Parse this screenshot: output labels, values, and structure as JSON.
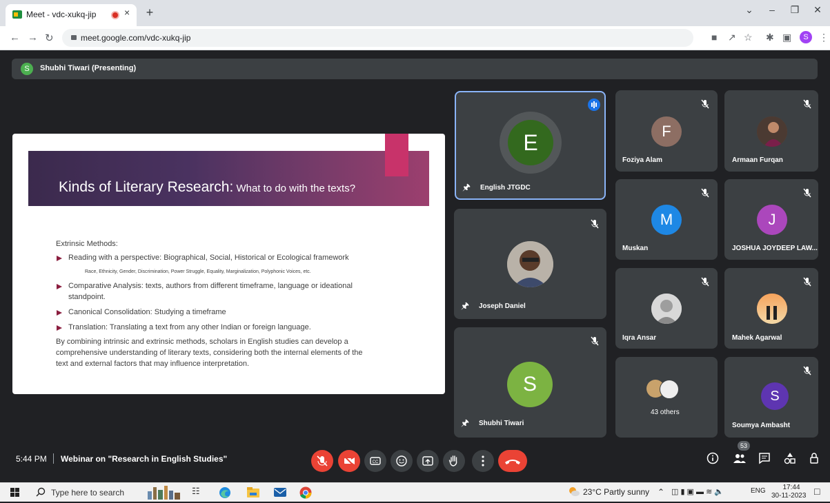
{
  "browser": {
    "tab_title": "Meet - vdc-xukq-jip",
    "tab_close": "×",
    "new_tab": "+",
    "url": "meet.google.com/vdc-xukq-jip",
    "profile_initial": "S",
    "window_controls": {
      "chevron": "⌄",
      "minimize": "–",
      "maximize": "❐",
      "close": "✕"
    }
  },
  "presenting_bar": {
    "avatar_initial": "S",
    "label": "Shubhi Tiwari (Presenting)"
  },
  "slide": {
    "title_main": "Kinds of Literary Research:",
    "title_sub": " What to do with the texts?",
    "section_heading": "Extrinsic Methods:",
    "bullets": [
      "Reading with a perspective: Biographical, Social, Historical or Ecological framework",
      "Comparative Analysis: texts, authors from different timeframe, language or ideational",
      "Canonical Consolidation: Studying a timeframe",
      "Translation: Translating a text from any other Indian or foreign language."
    ],
    "sub_note": "Race, Ethnicity, Gender, Discrimination, Power Struggle, Equality, Marginalization, Polyphonic Voices, etc.",
    "bullet2_continued": "standpoint.",
    "paragraph": [
      "By combining intrinsic and extrinsic methods, scholars in English studies can develop a",
      "comprehensive understanding of literary texts, considering both the internal elements of the",
      "text and external factors that may influence interpretation."
    ]
  },
  "participants": {
    "large": [
      {
        "name": "English JTGDC",
        "initial": "E",
        "avatar_color": "#33691e"
      },
      {
        "name": "Joseph Daniel"
      },
      {
        "name": "Shubhi Tiwari",
        "initial": "S",
        "avatar_color": "#7cb342"
      }
    ],
    "small": [
      {
        "name": "Foziya Alam",
        "initial": "F",
        "avatar_color": "#8d6e63"
      },
      {
        "name": "Armaan Furqan"
      },
      {
        "name": "Muskan",
        "initial": "M",
        "avatar_color": "#1e88e5"
      },
      {
        "name": "JOSHUA JOYDEEP LAW...",
        "initial": "J",
        "avatar_color": "#ab47bc"
      },
      {
        "name": "Iqra Ansar"
      },
      {
        "name": "Mahek Agarwal"
      },
      {
        "name": "43 others"
      },
      {
        "name": "Soumya Ambasht",
        "initial": "S",
        "avatar_color": "#5e35b1"
      }
    ]
  },
  "bottom_bar": {
    "time": "5:44 PM",
    "meeting_title": "Webinar on \"Research in English Studies\"",
    "people_count": "53"
  },
  "taskbar": {
    "search_placeholder": "Type here to search",
    "weather": "23°C  Partly sunny",
    "language": "ENG",
    "time": "17:44",
    "date": "30-11-2023"
  },
  "colors": {
    "meet_bg": "#202124",
    "tile_bg": "#3c4043",
    "active_speaker_border": "#8ab4f8",
    "end_call": "#ea4335"
  }
}
